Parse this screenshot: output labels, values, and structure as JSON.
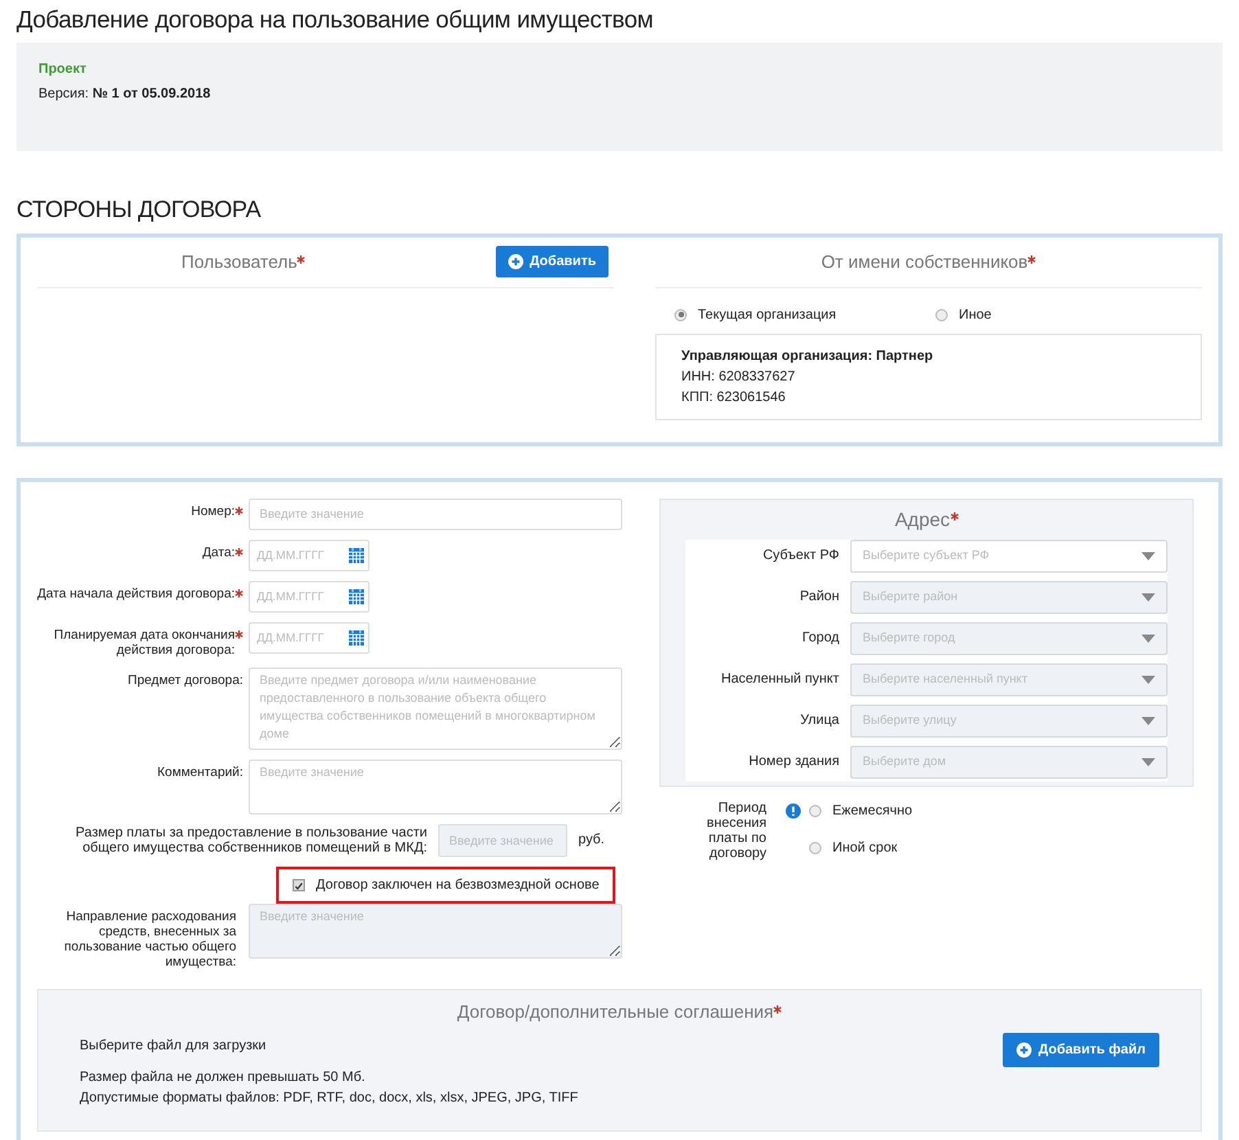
{
  "page_title": "Добавление договора на пользование общим имуществом",
  "status": {
    "label": "Проект",
    "version": "Версия: **№ 1 от 05.09.2018**"
  },
  "section_title": "СТОРОНЫ ДОГОВОРА",
  "parties": {
    "user": {
      "title": "Пользователь",
      "required": true,
      "button": "Добавить"
    },
    "owners": {
      "title": "От имени собственников",
      "required": true,
      "options": [
        {
          "label": "Текущая организация",
          "selected": true
        },
        {
          "label": "Иное",
          "selected": false
        }
      ],
      "org": {
        "name": "Управляющая организация: Партнер",
        "inn": "ИНН: 6208337627",
        "kpp": "КПП: 623061546"
      }
    }
  },
  "fields": [
    {
      "kind": "input",
      "label": "Номер:",
      "required": true,
      "placeholder": "Введите значение"
    },
    {
      "kind": "date",
      "label": "Дата:",
      "required": true,
      "placeholder": "ДД.ММ.ГГГГ"
    },
    {
      "kind": "date",
      "label": "Дата начала действия договора:",
      "required": true,
      "placeholder": "ДД.ММ.ГГГГ"
    },
    {
      "kind": "date",
      "label": "Планируемая дата окончания действия договора:",
      "required": true,
      "placeholder": "ДД.ММ.ГГГГ"
    },
    {
      "kind": "textarea",
      "label": "Предмет договора:",
      "required": false,
      "placeholder": "Введите предмет договора и/или наименование предоставленного в пользование объекта общего имущества собственников помещений в многоквартирном доме"
    },
    {
      "kind": "textarea",
      "label": "Комментарий:",
      "required": false,
      "placeholder": "Введите значение"
    }
  ],
  "fee": {
    "label": "Размер платы за предоставление в пользование части общего имущества собственников помещений в МКД:",
    "placeholder": "Введите значение",
    "disabled": true,
    "unit": "руб."
  },
  "free_basis": {
    "label": "Договор заключен на безвозмездной основе",
    "checked": true,
    "highlighted": true
  },
  "expense_direction": {
    "label": "Направление расходования средств, внесенных за пользование частью общего имущества:",
    "placeholder": "Введите значение",
    "disabled": true
  },
  "address": {
    "title": "Адрес",
    "required": true,
    "fields": [
      {
        "label": "Субъект РФ",
        "placeholder": "Выберите субъект РФ",
        "disabled": false
      },
      {
        "label": "Район",
        "placeholder": "Выберите район",
        "disabled": true
      },
      {
        "label": "Город",
        "placeholder": "Выберите город",
        "disabled": true
      },
      {
        "label": "Населенный пункт",
        "placeholder": "Выберите населенный пункт",
        "disabled": true
      },
      {
        "label": "Улица",
        "placeholder": "Выберите улицу",
        "disabled": true
      },
      {
        "label": "Номер здания",
        "placeholder": "Выберите дом",
        "disabled": true
      }
    ]
  },
  "payment_period": {
    "label": "Период внесения платы по договору",
    "options": [
      {
        "label": "Ежемесячно",
        "selected": false
      },
      {
        "label": "Иной срок",
        "selected": false
      }
    ]
  },
  "attachments": {
    "title": "Договор/дополнительные соглашения",
    "required": true,
    "prompt": "Выберите файл для загрузки",
    "size_note": "Размер файла не должен превышать 50 Мб.",
    "formats_note": "Допустимые форматы файлов: PDF, RTF, doc, docx, xls, xlsx, JPEG, JPG, TIFF",
    "button": "Добавить файл"
  }
}
